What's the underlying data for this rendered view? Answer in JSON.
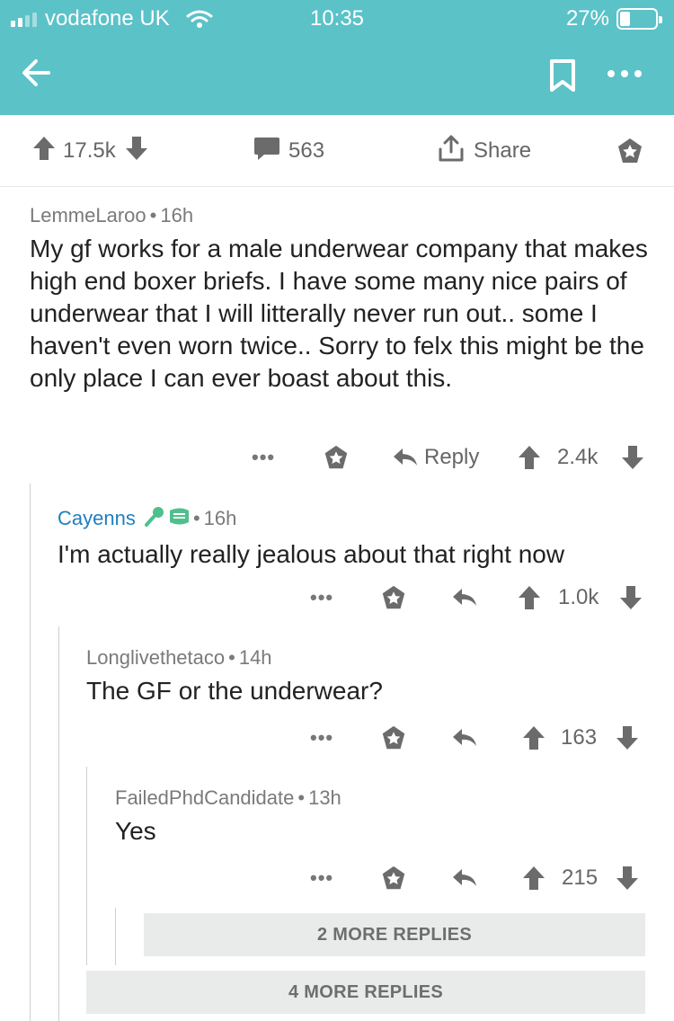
{
  "status_bar": {
    "carrier": "vodafone UK",
    "time": "10:35",
    "battery": "27%"
  },
  "colors": {
    "header": "#5bc2c8",
    "text": "#222222",
    "meta": "#7a7a7a",
    "link": "#1f7fbf"
  },
  "post_actions": {
    "score": "17.5k",
    "comments": "563",
    "share_label": "Share"
  },
  "comments": [
    {
      "author": "LemmeLaroo",
      "age": "16h",
      "body": "My gf works for a male underwear company that makes  high end boxer briefs. I have some many nice pairs of underwear that I will litterally never run out.. some I haven't even worn twice.. Sorry to felx this might be the only place I can ever boast about this.",
      "reply_label": "Reply",
      "score": "2.4k"
    },
    {
      "author": "Cayenns",
      "age": "16h",
      "body": "I'm actually really jealous about that right now",
      "score": "1.0k"
    },
    {
      "author": "Longlivethetaco",
      "age": "14h",
      "body": "The GF or the underwear?",
      "score": "163"
    },
    {
      "author": "FailedPhdCandidate",
      "age": "13h",
      "body": "Yes",
      "score": "215"
    }
  ],
  "more_replies": [
    {
      "label": "2 MORE REPLIES"
    },
    {
      "label": "4 MORE REPLIES"
    }
  ]
}
